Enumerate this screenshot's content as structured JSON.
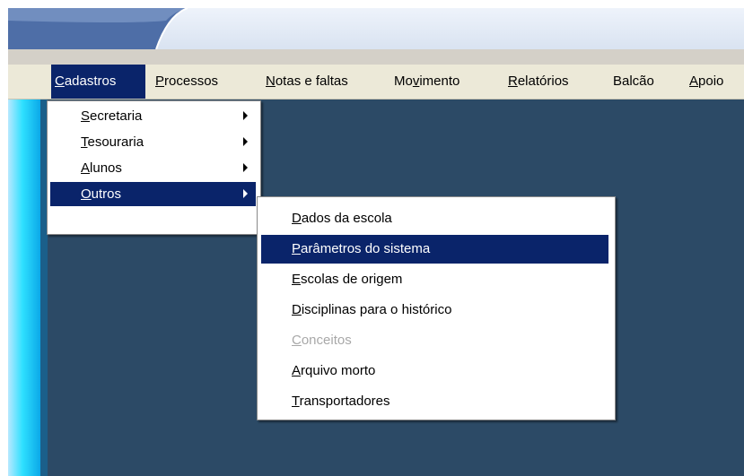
{
  "menubar": {
    "items": [
      {
        "pre": "",
        "mnem": "C",
        "post": "adastros"
      },
      {
        "pre": "",
        "mnem": "P",
        "post": "rocessos"
      },
      {
        "pre": "",
        "mnem": "N",
        "post": "otas e faltas"
      },
      {
        "pre": "Mo",
        "mnem": "v",
        "post": "imento"
      },
      {
        "pre": "",
        "mnem": "R",
        "post": "elatórios"
      },
      {
        "pre": "Balcão",
        "mnem": "",
        "post": ""
      },
      {
        "pre": "",
        "mnem": "A",
        "post": "poio"
      }
    ],
    "active_index": 0
  },
  "cadastros_menu": {
    "items": [
      {
        "mnem": "S",
        "rest": "ecretaria",
        "submenu": true
      },
      {
        "mnem": "T",
        "rest": "esouraria",
        "submenu": true
      },
      {
        "mnem": "A",
        "rest": "lunos",
        "submenu": true
      },
      {
        "mnem": "O",
        "rest": "utros",
        "submenu": true,
        "selected": true
      }
    ]
  },
  "outros_menu": {
    "items": [
      {
        "mnem": "D",
        "rest": "ados da escola"
      },
      {
        "mnem": "P",
        "rest": "arâmetros do sistema",
        "selected": true
      },
      {
        "mnem": "E",
        "rest": "scolas de origem"
      },
      {
        "mnem": "D",
        "rest": "isciplinas para o histórico"
      },
      {
        "mnem": "C",
        "rest": "onceitos",
        "disabled": true
      },
      {
        "mnem": "A",
        "rest": "rquivo morto"
      },
      {
        "mnem": "T",
        "rest": "ransportadores"
      }
    ]
  },
  "colors": {
    "selection": "#0a246a",
    "workspace": "#2c4a66",
    "menubar": "#ece9d8",
    "disabled_text": "#a8a8a8"
  }
}
